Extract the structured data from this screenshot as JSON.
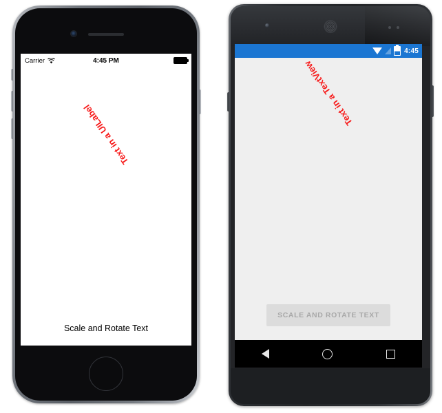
{
  "devices": {
    "ios": {
      "name": "iPhone",
      "status_bar": {
        "carrier": "Carrier",
        "wifi_icon": "wifi-icon",
        "time": "4:45 PM",
        "battery_icon": "battery-full-icon"
      },
      "rotated_label": "Text in a UILabel",
      "rotated_label_color": "#f71a1a",
      "rotated_label_rotation_deg": 235,
      "bottom_label": "Scale and Rotate Text",
      "screen_background": "#ffffff",
      "hardware": {
        "camera_icon": "front-camera-icon",
        "speaker_icon": "earpiece-speaker-icon",
        "home_button_icon": "home-button-icon"
      }
    },
    "android": {
      "name": "Android",
      "status_bar": {
        "wifi_icon": "wifi-icon",
        "signal_icon": "cell-signal-icon",
        "battery_icon": "battery-charging-icon",
        "time": "4:45",
        "background_color": "#1b76d2"
      },
      "rotated_label": "Text in a TextView",
      "rotated_label_color": "#f71a1a",
      "rotated_label_rotation_deg": 235,
      "button_label": "SCALE AND ROTATE TEXT",
      "screen_background": "#efefef",
      "nav_bar": {
        "back_icon": "back-triangle-icon",
        "home_icon": "home-circle-icon",
        "recents_icon": "recents-square-icon"
      },
      "hardware": {
        "camera_icon": "front-camera-icon",
        "earpiece_icon": "earpiece-speaker-icon",
        "sensor_icon": "proximity-sensor-icon"
      }
    }
  }
}
